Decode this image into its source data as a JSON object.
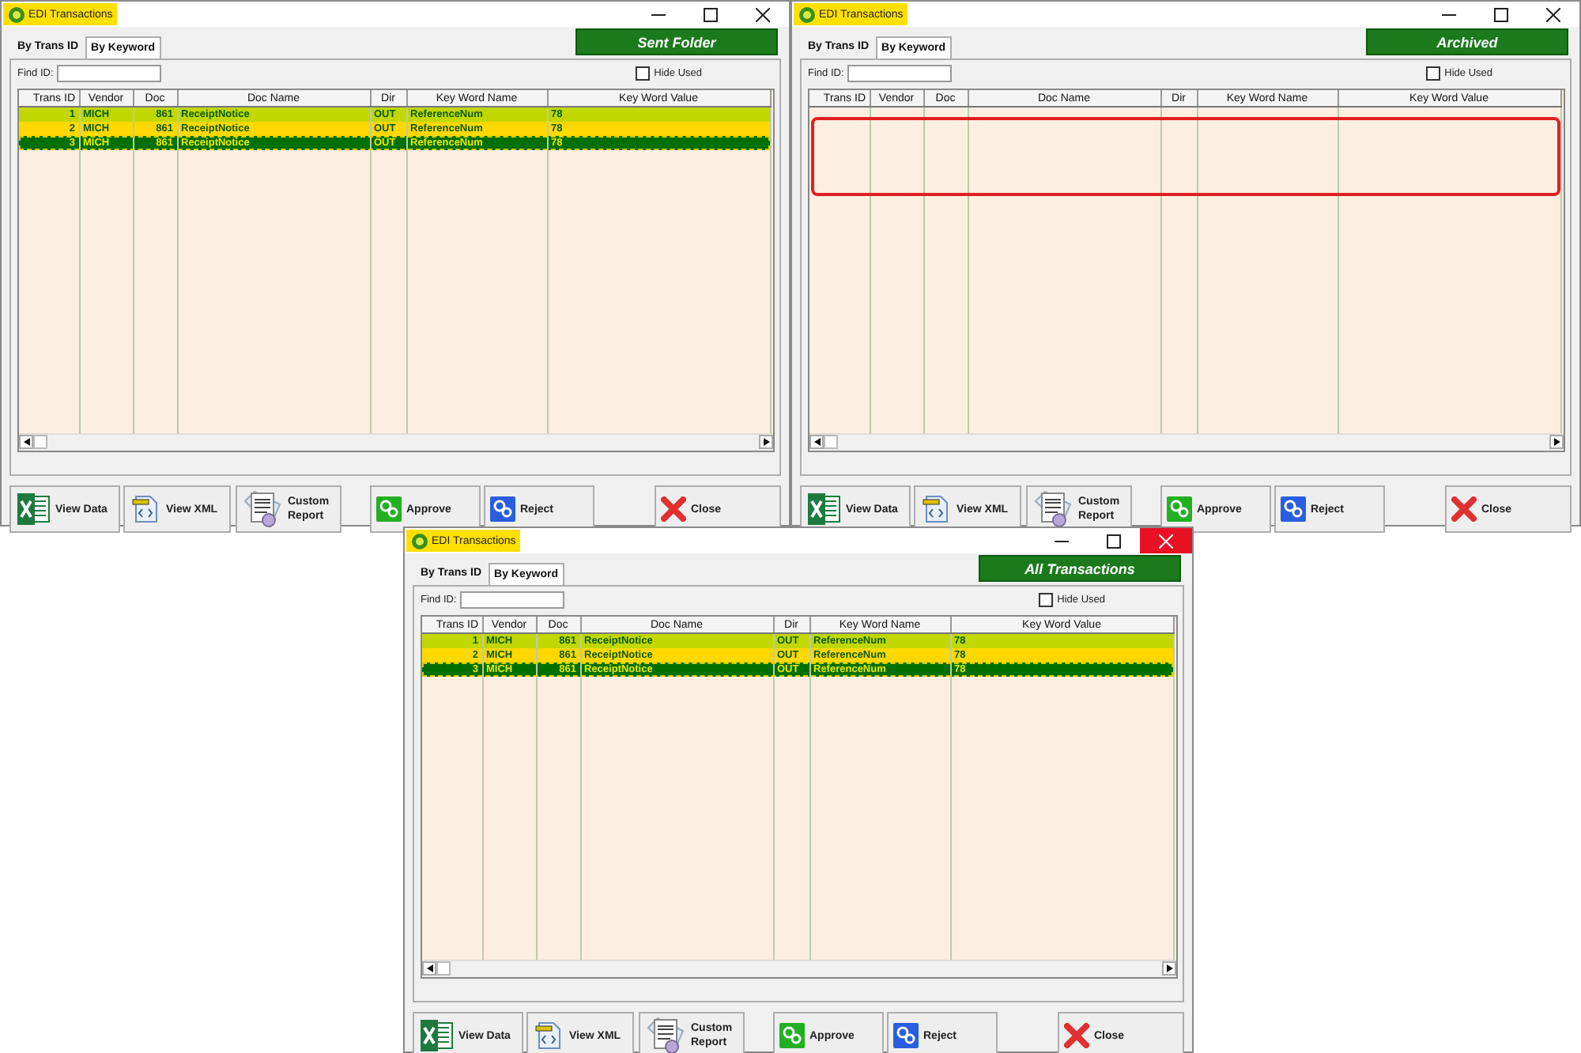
{
  "windows": [
    {
      "title": "EDI Transactions",
      "close_hover": false,
      "tabs": [
        {
          "label": "By Trans ID",
          "selected": true
        },
        {
          "label": "By Keyword",
          "selected": false
        }
      ],
      "banner": "Sent Folder",
      "find_label": "Find ID:",
      "hide_used": {
        "label": "Hide Used",
        "checked": false
      },
      "columns": [
        "Trans ID",
        "Vendor",
        "Doc",
        "Doc Name",
        "Dir",
        "Key Word Name",
        "Key Word Value"
      ],
      "rows": [
        {
          "cells": [
            "1",
            "MICH",
            "861",
            "ReceiptNotice",
            "OUT",
            "ReferenceNum",
            "78"
          ],
          "color": "#c0d800",
          "selected": false
        },
        {
          "cells": [
            "2",
            "MICH",
            "861",
            "ReceiptNotice",
            "OUT",
            "ReferenceNum",
            "78"
          ],
          "color": "#ffd800",
          "selected": false
        },
        {
          "cells": [
            "3",
            "MICH",
            "861",
            "ReceiptNotice",
            "OUT",
            "ReferenceNum",
            "78"
          ],
          "selected": true
        }
      ],
      "highlight": false,
      "buttons": [
        {
          "kind": "excel",
          "label": "View Data"
        },
        {
          "kind": "xml",
          "label": "View XML"
        },
        {
          "kind": "report",
          "label": "Custom Report"
        },
        {
          "kind": "approve",
          "label": "Approve"
        },
        {
          "kind": "reject",
          "label": "Reject"
        },
        {
          "kind": "close",
          "label": "Close"
        }
      ]
    },
    {
      "title": "EDI Transactions",
      "close_hover": false,
      "tabs": [
        {
          "label": "By Trans ID",
          "selected": true
        },
        {
          "label": "By Keyword",
          "selected": false
        }
      ],
      "banner": "Archived",
      "find_label": "Find ID:",
      "hide_used": {
        "label": "Hide Used",
        "checked": false
      },
      "columns": [
        "Trans ID",
        "Vendor",
        "Doc",
        "Doc Name",
        "Dir",
        "Key Word Name",
        "Key Word Value"
      ],
      "highlight": true,
      "buttons": [
        {
          "kind": "excel",
          "label": "View Data"
        },
        {
          "kind": "xml",
          "label": "View XML"
        },
        {
          "kind": "report",
          "label": "Custom Report"
        },
        {
          "kind": "approve",
          "label": "Approve"
        },
        {
          "kind": "reject",
          "label": "Reject"
        },
        {
          "kind": "close",
          "label": "Close"
        }
      ]
    },
    {
      "title": "EDI Transactions",
      "close_hover": true,
      "tabs": [
        {
          "label": "By Trans ID",
          "selected": true
        },
        {
          "label": "By Keyword",
          "selected": false
        }
      ],
      "banner": "All Transactions",
      "find_label": "Find ID:",
      "hide_used": {
        "label": "Hide Used",
        "checked": false
      },
      "columns": [
        "Trans ID",
        "Vendor",
        "Doc",
        "Doc Name",
        "Dir",
        "Key Word Name",
        "Key Word Value"
      ],
      "rows": [
        {
          "cells": [
            "1",
            "MICH",
            "861",
            "ReceiptNotice",
            "OUT",
            "ReferenceNum",
            "78"
          ],
          "color": "#c0d800",
          "selected": false
        },
        {
          "cells": [
            "2",
            "MICH",
            "861",
            "ReceiptNotice",
            "OUT",
            "ReferenceNum",
            "78"
          ],
          "color": "#ffd800",
          "selected": false
        },
        {
          "cells": [
            "3",
            "MICH",
            "861",
            "ReceiptNotice",
            "OUT",
            "ReferenceNum",
            "78"
          ],
          "selected": true
        }
      ],
      "highlight": false,
      "buttons": [
        {
          "kind": "excel",
          "label": "View Data"
        },
        {
          "kind": "xml",
          "label": "View XML"
        },
        {
          "kind": "report",
          "label": "Custom Report"
        },
        {
          "kind": "approve",
          "label": "Approve"
        },
        {
          "kind": "reject",
          "label": "Reject"
        },
        {
          "kind": "close",
          "label": "Close"
        }
      ]
    }
  ]
}
